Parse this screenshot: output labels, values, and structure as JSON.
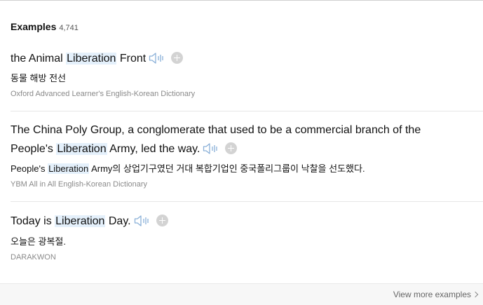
{
  "header": {
    "title": "Examples",
    "count": "4,741"
  },
  "examples": [
    {
      "sentence_before": "the Animal ",
      "highlight": "Liberation",
      "sentence_after": " Front",
      "translation": "동물 해방 전선",
      "source": "Oxford Advanced Learner's English-Korean Dictionary"
    },
    {
      "sentence_before": "The China Poly Group, a conglomerate that used to be a commercial branch of the People's ",
      "highlight": "Liberation",
      "sentence_after": " Army, led the way.",
      "translation_before": "People's ",
      "translation_highlight": "Liberation",
      "translation_after": " Army의 상업기구였던 거대 복합기업인 중국폴리그룹이 낙찰을 선도했다.",
      "source": "YBM All in All English-Korean Dictionary"
    },
    {
      "sentence_before": "Today is ",
      "highlight": "Liberation",
      "sentence_after": " Day.",
      "translation": "오늘은 광복절.",
      "source": "DARAKWON"
    }
  ],
  "footer": {
    "view_more": "View more examples"
  },
  "icons": {
    "speaker": "speaker-icon",
    "add": "plus-circle-icon",
    "chevron": "chevron-right-icon"
  },
  "colors": {
    "highlight": "#e4f0fb",
    "speaker": "#8ab0d8",
    "add": "#d3d3d3"
  }
}
